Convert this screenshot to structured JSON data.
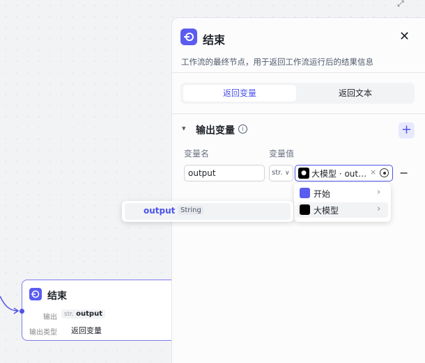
{
  "canvas": {
    "node": {
      "title": "结束",
      "output_label": "输出",
      "output_type_tag": "str.",
      "output_name": "output",
      "type_label": "输出类型",
      "type_value": "返回变量"
    }
  },
  "panel": {
    "title": "结束",
    "description": "工作流的最终节点，用于返回工作流运行后的结果信息",
    "tabs": [
      {
        "label": "返回变量",
        "active": true
      },
      {
        "label": "返回文本",
        "active": false
      }
    ],
    "section": {
      "title": "输出变量",
      "col_name": "变量名",
      "col_value": "变量值",
      "row": {
        "name": "output",
        "type": "str.",
        "value_text": "大模型 · out…"
      }
    }
  },
  "menu": {
    "items": [
      {
        "label": "开始"
      },
      {
        "label": "大模型"
      }
    ]
  },
  "submenu": {
    "name": "output",
    "type": "String"
  },
  "colors": {
    "accent": "#4d53e8",
    "icon_bg": "#5a5cf0"
  }
}
